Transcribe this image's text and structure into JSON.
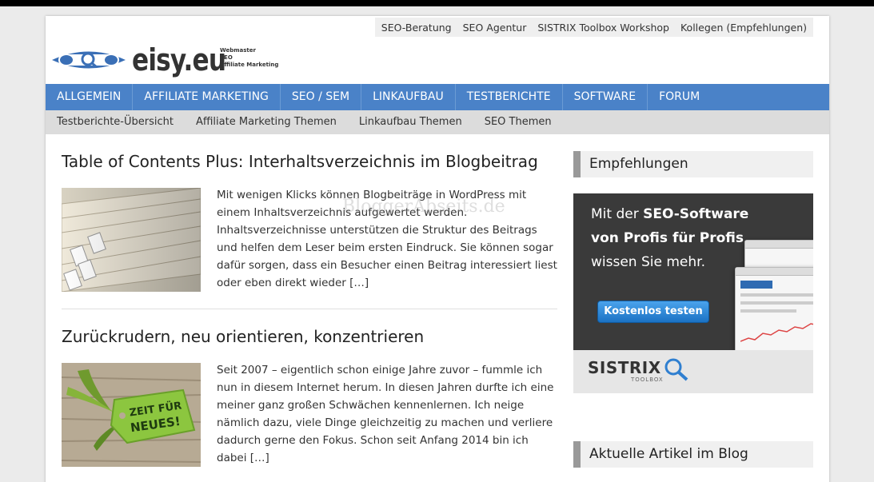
{
  "toplinks": [
    "SEO-Beratung",
    "SEO Agentur",
    "SISTRIX Toolbox Workshop",
    "Kollegen (Empfehlungen)"
  ],
  "logo": {
    "text": "eisy.eu",
    "tagline": [
      "Webmaster",
      "SEO",
      "Affiliate Marketing"
    ]
  },
  "mainnav": [
    "ALLGEMEIN",
    "AFFILIATE MARKETING",
    "SEO / SEM",
    "LINKAUFBAU",
    "TESTBERICHTE",
    "SOFTWARE",
    "FORUM"
  ],
  "subnav": [
    "Testberichte-Übersicht",
    "Affiliate Marketing Themen",
    "Linkaufbau Themen",
    "SEO Themen"
  ],
  "articles": [
    {
      "title": "Table of Contents Plus: Interhaltsverzeichnis im Blogbeitrag",
      "lines": [
        "Mit wenigen Klicks können Blogbeiträge in WordPress mit",
        "einem Inhaltsverzeichnis aufgewertet werden.",
        "Inhaltsverzeichnisse unterstützen die Struktur des Beitrags",
        "und helfen dem Leser beim ersten Eindruck. Sie können sogar",
        "dafür sorgen, dass ein Besucher einen Beitrag interessiert liest",
        "oder eben direkt wieder […]"
      ]
    },
    {
      "title": "Zurückrudern, neu orientieren, konzentrieren",
      "lines": [
        "Seit 2007 – eigentlich schon einige Jahre zuvor – fummle ich",
        "nun in diesem Internet herum. In diesen Jahren durfte ich eine",
        "meiner ganz großen Schwächen kennenlernen. Ich neige",
        "nämlich dazu, viele Dinge gleichzeitig zu machen und verliere",
        "dadurch gerne den Fokus. Schon seit Anfang 2014 bin ich",
        "dabei […]"
      ],
      "image_text": [
        "ZEIT FÜR",
        "NEUES!"
      ]
    }
  ],
  "sidebar": {
    "widget1_title": "Empfehlungen",
    "widget2_title": "Aktuelle Artikel im Blog",
    "ad": {
      "line1_prefix": "Mit der ",
      "line1_bold": "SEO-Software",
      "line2": "von Profis für Profis",
      "line3": "wissen Sie mehr.",
      "button": "Kostenlos testen",
      "brand": "SISTRIX",
      "brand_sub": "TOOLBOX"
    }
  },
  "watermark": "BloggerAbseits.de",
  "colors": {
    "nav": "#4a82c8",
    "subnav": "#dcdcdc",
    "logo_blue": "#3a6fb6",
    "ad_button": "#1b72c4"
  }
}
